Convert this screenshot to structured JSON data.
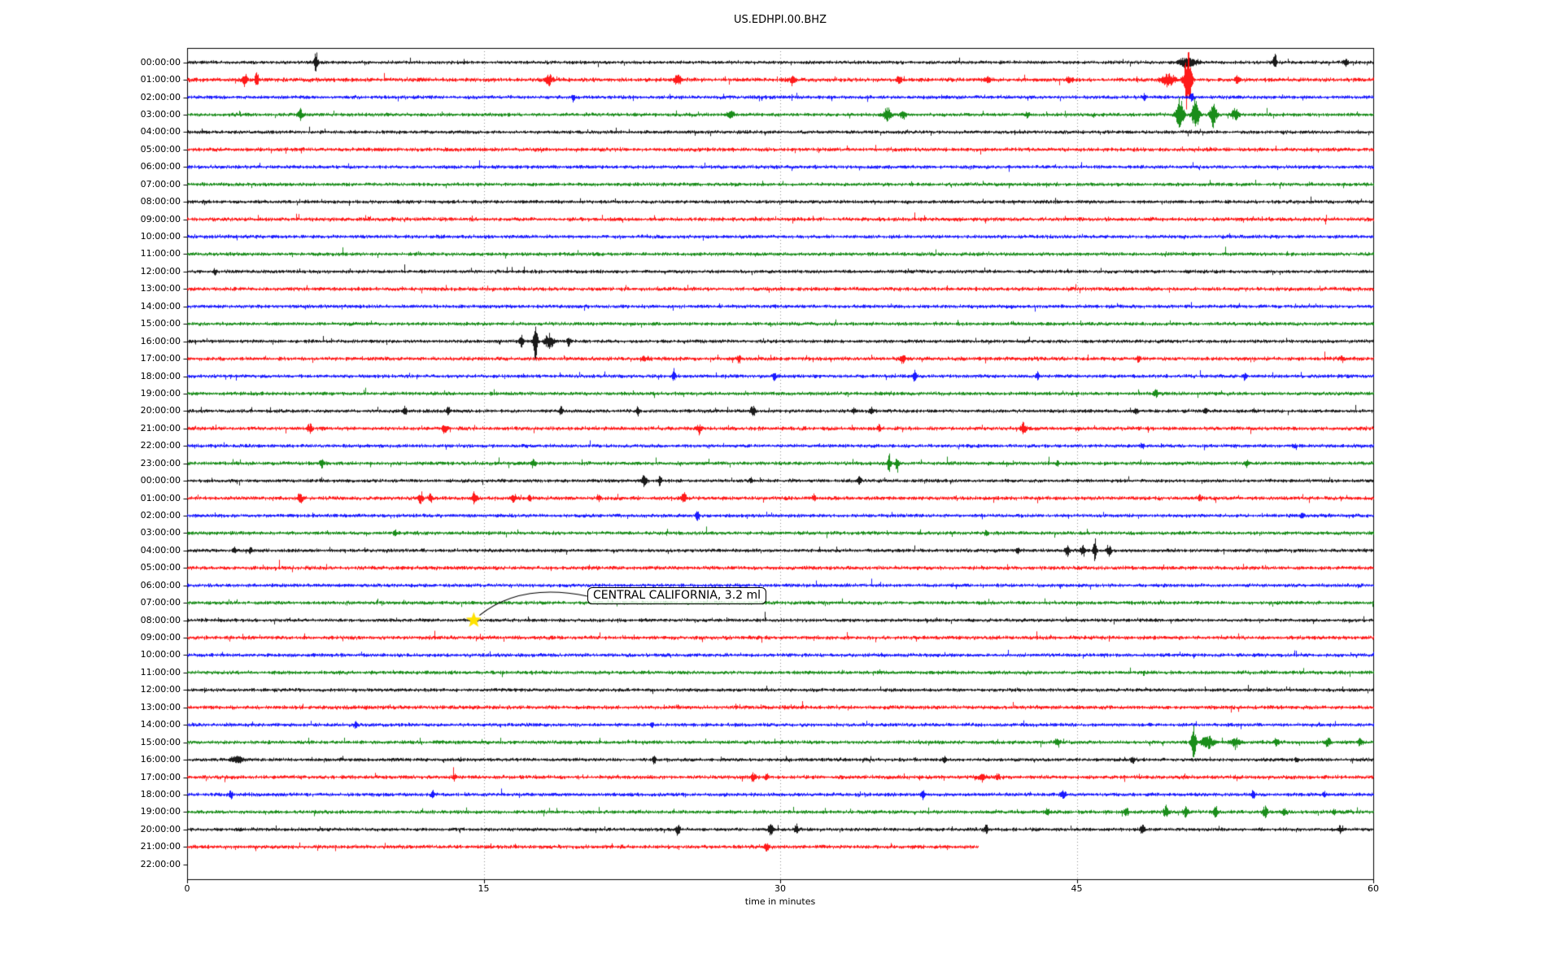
{
  "title": "US.EDHPI.00.BHZ",
  "xaxis": {
    "label": "time in minutes",
    "ticks": [
      {
        "label": "0",
        "value": 0
      },
      {
        "label": "15",
        "value": 15
      },
      {
        "label": "30",
        "value": 30
      },
      {
        "label": "45",
        "value": 45
      },
      {
        "label": "60",
        "value": 60
      }
    ]
  },
  "annotation": {
    "text": "CENTRAL CALIFORNIA, 3.2 ml",
    "row_label": "08:00:00",
    "minute": 14.5
  },
  "colors": {
    "black_trace": "#000000",
    "red_trace": "#ff0000",
    "blue_trace": "#0000ff",
    "green_trace": "#008000",
    "grid": "#888888",
    "star": "#ffe200",
    "axis": "#000000"
  },
  "chart_data": {
    "type": "line",
    "subtype": "seismogram-helicorder-dayplot",
    "title": "US.EDHPI.00.BHZ",
    "xlabel": "time in minutes",
    "xlim": [
      0,
      60
    ],
    "xticks": [
      0,
      15,
      30,
      45,
      60
    ],
    "grid": "vertical-dotted-at-15-30-45",
    "minutes_per_row": 60,
    "color_cycle": [
      "#000000",
      "#ff0000",
      "#0000ff",
      "#008000"
    ],
    "star_marker": {
      "row_index": 32,
      "minute": 14.5,
      "label": "CENTRAL CALIFORNIA, 3.2 ml"
    },
    "rows": [
      {
        "label": "00:00:00",
        "color": "#000000",
        "noise": 2.2,
        "events": [
          [
            6.5,
            16,
            1.5
          ],
          [
            50.6,
            6,
            8
          ],
          [
            55.0,
            12,
            1.5
          ],
          [
            58.6,
            4,
            2
          ]
        ]
      },
      {
        "label": "01:00:00",
        "color": "#ff0000",
        "noise": 2.7,
        "events": [
          [
            2.9,
            8,
            2
          ],
          [
            3.5,
            10,
            1.5
          ],
          [
            18.3,
            6,
            3
          ],
          [
            24.8,
            7,
            3
          ],
          [
            30.6,
            5,
            2
          ],
          [
            36.0,
            5,
            2
          ],
          [
            40.5,
            4,
            2
          ],
          [
            44.6,
            4,
            2
          ],
          [
            49.6,
            7,
            6
          ],
          [
            50.6,
            42,
            3
          ],
          [
            53.1,
            5,
            2
          ]
        ]
      },
      {
        "label": "02:00:00",
        "color": "#0000ff",
        "noise": 2.3,
        "events": [
          [
            19.5,
            5,
            1.5
          ],
          [
            48.4,
            4,
            1.5
          ],
          [
            50.8,
            4,
            2
          ]
        ]
      },
      {
        "label": "03:00:00",
        "color": "#008000",
        "noise": 2.3,
        "events": [
          [
            5.7,
            8,
            2
          ],
          [
            27.5,
            4,
            3
          ],
          [
            35.4,
            9,
            3
          ],
          [
            36.2,
            7,
            2
          ],
          [
            42.5,
            4,
            2
          ],
          [
            50.2,
            24,
            3
          ],
          [
            51.0,
            20,
            3
          ],
          [
            51.9,
            16,
            2.5
          ],
          [
            53.0,
            7,
            3
          ]
        ]
      },
      {
        "label": "04:00:00",
        "color": "#000000",
        "noise": 2.2,
        "events": []
      },
      {
        "label": "05:00:00",
        "color": "#ff0000",
        "noise": 2.5,
        "events": []
      },
      {
        "label": "06:00:00",
        "color": "#0000ff",
        "noise": 2.3,
        "events": []
      },
      {
        "label": "07:00:00",
        "color": "#008000",
        "noise": 2.3,
        "events": []
      },
      {
        "label": "08:00:00",
        "color": "#000000",
        "noise": 2.2,
        "events": []
      },
      {
        "label": "09:00:00",
        "color": "#ff0000",
        "noise": 2.5,
        "events": []
      },
      {
        "label": "10:00:00",
        "color": "#0000ff",
        "noise": 2.3,
        "events": []
      },
      {
        "label": "11:00:00",
        "color": "#008000",
        "noise": 2.3,
        "events": []
      },
      {
        "label": "12:00:00",
        "color": "#000000",
        "noise": 2.2,
        "events": [
          [
            1.4,
            4,
            1.5
          ]
        ]
      },
      {
        "label": "13:00:00",
        "color": "#ff0000",
        "noise": 2.5,
        "events": []
      },
      {
        "label": "14:00:00",
        "color": "#0000ff",
        "noise": 2.3,
        "events": []
      },
      {
        "label": "15:00:00",
        "color": "#008000",
        "noise": 2.3,
        "events": []
      },
      {
        "label": "16:00:00",
        "color": "#000000",
        "noise": 2.2,
        "events": [
          [
            16.9,
            8,
            2
          ],
          [
            17.6,
            26,
            1.8
          ],
          [
            18.3,
            9,
            4
          ],
          [
            19.3,
            7,
            1.5
          ]
        ]
      },
      {
        "label": "17:00:00",
        "color": "#ff0000",
        "noise": 2.5,
        "events": [
          [
            23.1,
            4,
            1.5
          ],
          [
            27.9,
            5,
            1.5
          ],
          [
            36.2,
            6,
            2
          ],
          [
            48.1,
            4,
            1.5
          ],
          [
            58.4,
            4,
            1.5
          ]
        ]
      },
      {
        "label": "18:00:00",
        "color": "#0000ff",
        "noise": 2.3,
        "events": [
          [
            24.6,
            6,
            1.5
          ],
          [
            29.7,
            5,
            1.5
          ],
          [
            36.8,
            8,
            1.5
          ],
          [
            43.0,
            5,
            1.5
          ],
          [
            53.5,
            4,
            1.5
          ]
        ]
      },
      {
        "label": "19:00:00",
        "color": "#008000",
        "noise": 2.3,
        "events": [
          [
            49.0,
            5,
            2
          ]
        ]
      },
      {
        "label": "20:00:00",
        "color": "#000000",
        "noise": 2.2,
        "events": [
          [
            11.0,
            6,
            1.5
          ],
          [
            13.2,
            5,
            1.5
          ],
          [
            18.9,
            5,
            1.5
          ],
          [
            22.8,
            5,
            1.5
          ],
          [
            28.6,
            7,
            2
          ],
          [
            33.7,
            5,
            1.5
          ],
          [
            34.6,
            4,
            1.5
          ],
          [
            48.0,
            4,
            1.5
          ],
          [
            51.5,
            4,
            1.5
          ]
        ]
      },
      {
        "label": "21:00:00",
        "color": "#ff0000",
        "noise": 2.5,
        "events": [
          [
            6.2,
            6,
            2
          ],
          [
            13.0,
            7,
            2
          ],
          [
            25.9,
            6,
            2
          ],
          [
            35.0,
            4,
            1.5
          ],
          [
            42.3,
            7,
            2
          ]
        ]
      },
      {
        "label": "22:00:00",
        "color": "#0000ff",
        "noise": 2.3,
        "events": [
          [
            48.3,
            4,
            1.5
          ],
          [
            56.0,
            3,
            1.5
          ]
        ]
      },
      {
        "label": "23:00:00",
        "color": "#008000",
        "noise": 2.3,
        "events": [
          [
            6.8,
            5,
            2
          ],
          [
            17.5,
            5,
            2
          ],
          [
            35.5,
            12,
            1.5
          ],
          [
            35.9,
            10,
            1.5
          ],
          [
            44.0,
            3,
            1.5
          ],
          [
            53.6,
            4,
            1.5
          ]
        ]
      },
      {
        "label": "00:00:00",
        "color": "#000000",
        "noise": 2.2,
        "events": [
          [
            23.1,
            7,
            2
          ],
          [
            23.9,
            6,
            1.5
          ],
          [
            28.5,
            4,
            1.5
          ],
          [
            34.0,
            6,
            1.5
          ]
        ]
      },
      {
        "label": "01:00:00",
        "color": "#ff0000",
        "noise": 2.5,
        "events": [
          [
            5.7,
            7,
            2
          ],
          [
            11.8,
            8,
            2
          ],
          [
            12.3,
            7,
            1.5
          ],
          [
            14.5,
            7,
            2
          ],
          [
            16.5,
            6,
            2
          ],
          [
            17.3,
            5,
            1.5
          ],
          [
            20.8,
            4,
            1.5
          ],
          [
            25.1,
            7,
            2
          ],
          [
            31.7,
            4,
            1.5
          ],
          [
            51.2,
            5,
            1.5
          ]
        ]
      },
      {
        "label": "02:00:00",
        "color": "#0000ff",
        "noise": 2.3,
        "events": [
          [
            25.8,
            8,
            1.5
          ],
          [
            56.4,
            4,
            1.5
          ]
        ]
      },
      {
        "label": "03:00:00",
        "color": "#008000",
        "noise": 2.3,
        "events": [
          [
            10.5,
            3,
            1.5
          ],
          [
            40.4,
            4,
            1.5
          ]
        ]
      },
      {
        "label": "04:00:00",
        "color": "#000000",
        "noise": 2.2,
        "events": [
          [
            2.4,
            4,
            1.5
          ],
          [
            3.2,
            4,
            1.5
          ],
          [
            42.0,
            4,
            1.5
          ],
          [
            44.5,
            7,
            2
          ],
          [
            45.3,
            8,
            2
          ],
          [
            45.9,
            15,
            1.5
          ],
          [
            46.6,
            7,
            2
          ]
        ]
      },
      {
        "label": "05:00:00",
        "color": "#ff0000",
        "noise": 2.5,
        "events": []
      },
      {
        "label": "06:00:00",
        "color": "#0000ff",
        "noise": 2.3,
        "events": []
      },
      {
        "label": "07:00:00",
        "color": "#008000",
        "noise": 2.3,
        "events": []
      },
      {
        "label": "08:00:00",
        "color": "#000000",
        "noise": 2.2,
        "events": [
          [
            14.5,
            3,
            2
          ]
        ]
      },
      {
        "label": "09:00:00",
        "color": "#ff0000",
        "noise": 2.5,
        "events": []
      },
      {
        "label": "10:00:00",
        "color": "#0000ff",
        "noise": 2.3,
        "events": []
      },
      {
        "label": "11:00:00",
        "color": "#008000",
        "noise": 2.3,
        "events": []
      },
      {
        "label": "12:00:00",
        "color": "#000000",
        "noise": 2.2,
        "events": []
      },
      {
        "label": "13:00:00",
        "color": "#ff0000",
        "noise": 2.5,
        "events": []
      },
      {
        "label": "14:00:00",
        "color": "#0000ff",
        "noise": 2.3,
        "events": [
          [
            8.5,
            4,
            1.5
          ],
          [
            23.5,
            3,
            1.5
          ]
        ]
      },
      {
        "label": "15:00:00",
        "color": "#008000",
        "noise": 2.3,
        "events": [
          [
            44.0,
            4,
            2
          ],
          [
            50.9,
            20,
            2
          ],
          [
            51.6,
            9,
            5
          ],
          [
            53.0,
            6,
            4
          ],
          [
            55.1,
            6,
            2
          ],
          [
            57.7,
            7,
            2
          ],
          [
            59.3,
            5,
            2
          ]
        ]
      },
      {
        "label": "16:00:00",
        "color": "#000000",
        "noise": 2.2,
        "events": [
          [
            2.5,
            4,
            5
          ],
          [
            23.6,
            5,
            1.5
          ],
          [
            38.3,
            4,
            1.5
          ],
          [
            47.8,
            5,
            1.5
          ],
          [
            56.1,
            4,
            1.5
          ]
        ]
      },
      {
        "label": "17:00:00",
        "color": "#ff0000",
        "noise": 2.5,
        "events": [
          [
            13.5,
            4,
            1.5
          ],
          [
            28.6,
            5,
            2
          ],
          [
            29.3,
            4,
            1.5
          ],
          [
            40.2,
            6,
            2
          ],
          [
            41.0,
            5,
            1.5
          ]
        ]
      },
      {
        "label": "18:00:00",
        "color": "#0000ff",
        "noise": 2.3,
        "events": [
          [
            2.2,
            5,
            1.5
          ],
          [
            12.4,
            4,
            1.5
          ],
          [
            37.2,
            5,
            1.5
          ],
          [
            44.3,
            7,
            2
          ],
          [
            53.9,
            5,
            1.5
          ],
          [
            57.5,
            4,
            1.5
          ]
        ]
      },
      {
        "label": "19:00:00",
        "color": "#008000",
        "noise": 2.3,
        "events": [
          [
            43.5,
            4,
            2
          ],
          [
            47.5,
            5,
            2
          ],
          [
            49.5,
            8,
            2
          ],
          [
            50.5,
            7,
            2
          ],
          [
            52.0,
            6,
            2
          ],
          [
            54.5,
            8,
            2
          ],
          [
            55.5,
            5,
            2
          ],
          [
            58.0,
            4,
            1.5
          ]
        ]
      },
      {
        "label": "20:00:00",
        "color": "#000000",
        "noise": 2.2,
        "events": [
          [
            24.8,
            7,
            2
          ],
          [
            29.5,
            8,
            2
          ],
          [
            30.8,
            6,
            1.5
          ],
          [
            40.4,
            6,
            1.5
          ],
          [
            48.3,
            6,
            2
          ],
          [
            58.3,
            4,
            1.5
          ]
        ]
      },
      {
        "label": "21:00:00",
        "color": "#ff0000",
        "noise": 2.5,
        "end": 40,
        "events": [
          [
            29.3,
            5,
            2
          ]
        ]
      },
      {
        "label": "22:00:00",
        "trace": false
      }
    ]
  }
}
